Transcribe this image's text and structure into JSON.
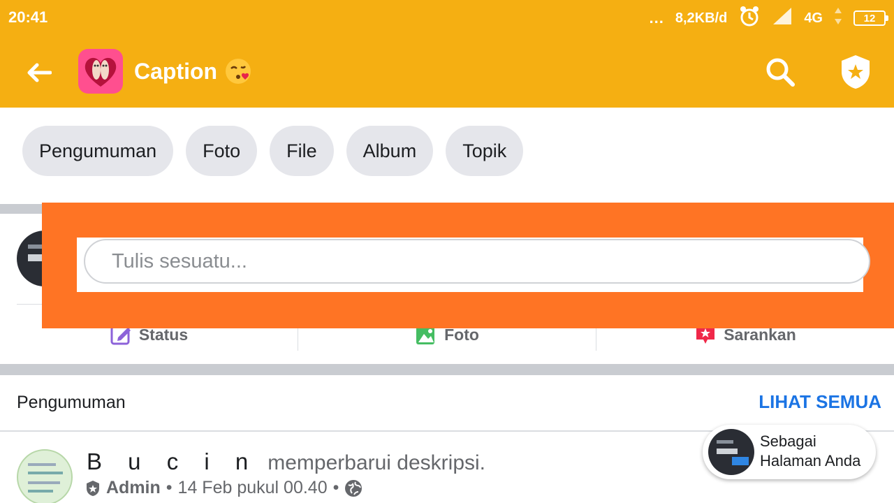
{
  "status_bar": {
    "time": "20:41",
    "dots": "...",
    "speed": "8,2KB/d",
    "network": "4G",
    "battery": "12"
  },
  "app_bar": {
    "title": "Caption",
    "icons": [
      "back-arrow-icon",
      "group-avatar",
      "kiss-emoji-icon",
      "search-icon",
      "shield-star-icon"
    ]
  },
  "chips": [
    "Pengumuman",
    "Foto",
    "File",
    "Album",
    "Topik"
  ],
  "composer": {
    "placeholder": "Tulis sesuatu...",
    "actions": [
      {
        "label": "Status",
        "icon": "edit-icon",
        "color": "#8c62d9"
      },
      {
        "label": "Foto",
        "icon": "photo-icon",
        "color": "#45bd62"
      },
      {
        "label": "Sarankan",
        "icon": "suggest-icon",
        "color": "#f02849"
      }
    ]
  },
  "announcements": {
    "title": "Pengumuman",
    "see_all": "LIHAT SEMUA",
    "post": {
      "author": "B u c i n",
      "action": "memperbarui deskripsi.",
      "role": "Admin",
      "separator": "•",
      "time": "14 Feb pukul 00.40"
    }
  },
  "page_pill": {
    "line1": "Sebagai",
    "line2": "Halaman Anda"
  },
  "colors": {
    "app_bar": "#f5af12",
    "highlight": "#ff7424",
    "link": "#1b74e4"
  }
}
